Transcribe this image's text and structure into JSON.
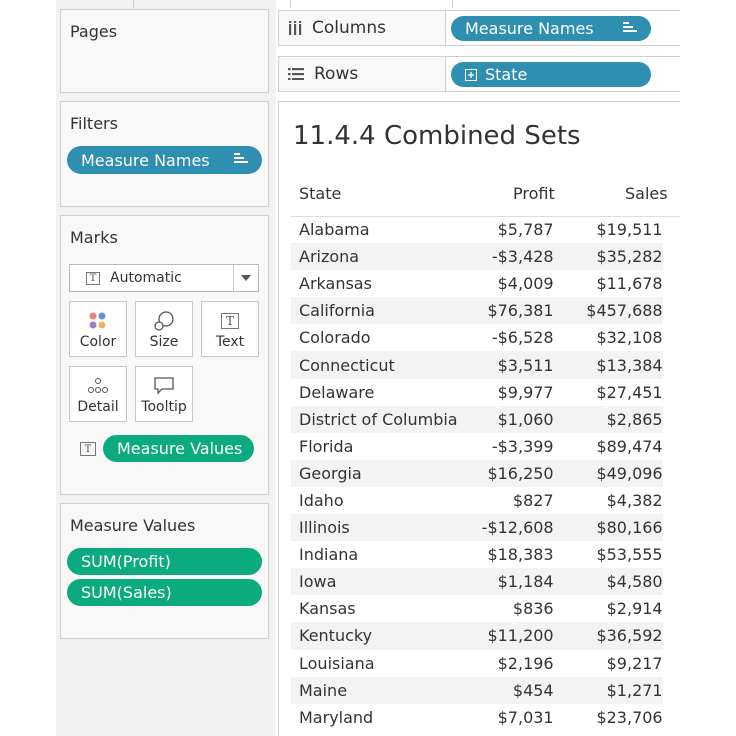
{
  "pages_card": {
    "title": "Pages"
  },
  "filters_card": {
    "title": "Filters",
    "pill": "Measure Names"
  },
  "marks_card": {
    "title": "Marks",
    "mark_type": "Automatic",
    "buttons": {
      "color": "Color",
      "size": "Size",
      "text": "Text",
      "detail": "Detail",
      "tooltip": "Tooltip"
    },
    "pill": "Measure Values"
  },
  "measure_values_card": {
    "title": "Measure Values",
    "pills": [
      "SUM(Profit)",
      "SUM(Sales)"
    ]
  },
  "shelves": {
    "columns_label": "Columns",
    "columns_pill": "Measure Names",
    "rows_label": "Rows",
    "rows_pill": "State"
  },
  "colors": {
    "blue_pill": "#2f8fb0",
    "green_pill": "#0cab7f"
  },
  "view": {
    "title": "11.4.4 Combined Sets",
    "headers": {
      "state": "State",
      "profit": "Profit",
      "sales": "Sales"
    },
    "rows": [
      {
        "state": "Alabama",
        "profit": "$5,787",
        "sales": "$19,511"
      },
      {
        "state": "Arizona",
        "profit": "-$3,428",
        "sales": "$35,282"
      },
      {
        "state": "Arkansas",
        "profit": "$4,009",
        "sales": "$11,678"
      },
      {
        "state": "California",
        "profit": "$76,381",
        "sales": "$457,688"
      },
      {
        "state": "Colorado",
        "profit": "-$6,528",
        "sales": "$32,108"
      },
      {
        "state": "Connecticut",
        "profit": "$3,511",
        "sales": "$13,384"
      },
      {
        "state": "Delaware",
        "profit": "$9,977",
        "sales": "$27,451"
      },
      {
        "state": "District of Columbia",
        "profit": "$1,060",
        "sales": "$2,865"
      },
      {
        "state": "Florida",
        "profit": "-$3,399",
        "sales": "$89,474"
      },
      {
        "state": "Georgia",
        "profit": "$16,250",
        "sales": "$49,096"
      },
      {
        "state": "Idaho",
        "profit": "$827",
        "sales": "$4,382"
      },
      {
        "state": "Illinois",
        "profit": "-$12,608",
        "sales": "$80,166"
      },
      {
        "state": "Indiana",
        "profit": "$18,383",
        "sales": "$53,555"
      },
      {
        "state": "Iowa",
        "profit": "$1,184",
        "sales": "$4,580"
      },
      {
        "state": "Kansas",
        "profit": "$836",
        "sales": "$2,914"
      },
      {
        "state": "Kentucky",
        "profit": "$11,200",
        "sales": "$36,592"
      },
      {
        "state": "Louisiana",
        "profit": "$2,196",
        "sales": "$9,217"
      },
      {
        "state": "Maine",
        "profit": "$454",
        "sales": "$1,271"
      },
      {
        "state": "Maryland",
        "profit": "$7,031",
        "sales": "$23,706"
      }
    ]
  }
}
